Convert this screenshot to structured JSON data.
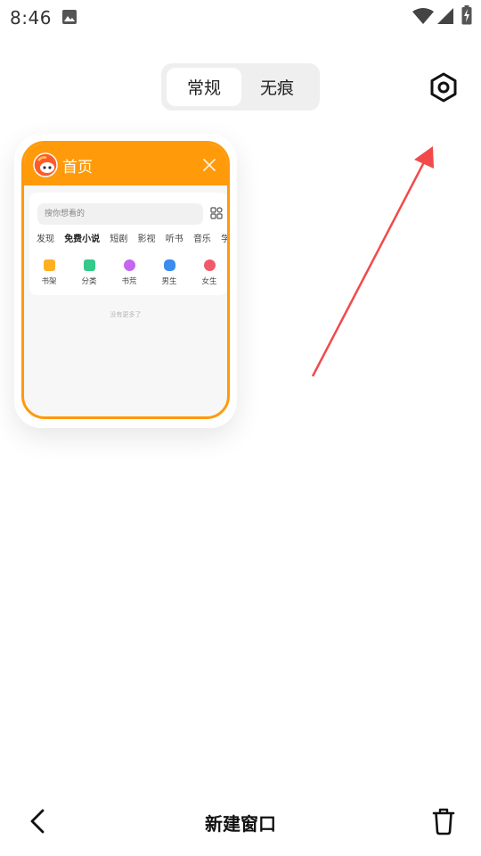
{
  "status_bar": {
    "time": "8:46"
  },
  "mode_toggle": {
    "normal_label": "常规",
    "incognito_label": "无痕",
    "selected": "常规"
  },
  "settings": {
    "icon": "hexagon-settings-icon"
  },
  "tab_card": {
    "title": "首页",
    "accent_color": "#ff9a0b",
    "search_placeholder": "搜你想看的",
    "categories": [
      "发现",
      "免费小说",
      "短剧",
      "影视",
      "听书",
      "音乐",
      "学习"
    ],
    "active_category": "免费小说",
    "shortcuts": [
      {
        "label": "书架",
        "color": "#ffb020"
      },
      {
        "label": "分类",
        "color": "#35c98a"
      },
      {
        "label": "书荒",
        "color": "#c565f0"
      },
      {
        "label": "男生",
        "color": "#3a8cf0"
      },
      {
        "label": "女生",
        "color": "#f05a6a"
      }
    ],
    "empty_text": "没有更多了"
  },
  "annotation": {
    "arrow_color": "#f24a4a"
  },
  "bottom_bar": {
    "new_window_label": "新建窗口"
  }
}
